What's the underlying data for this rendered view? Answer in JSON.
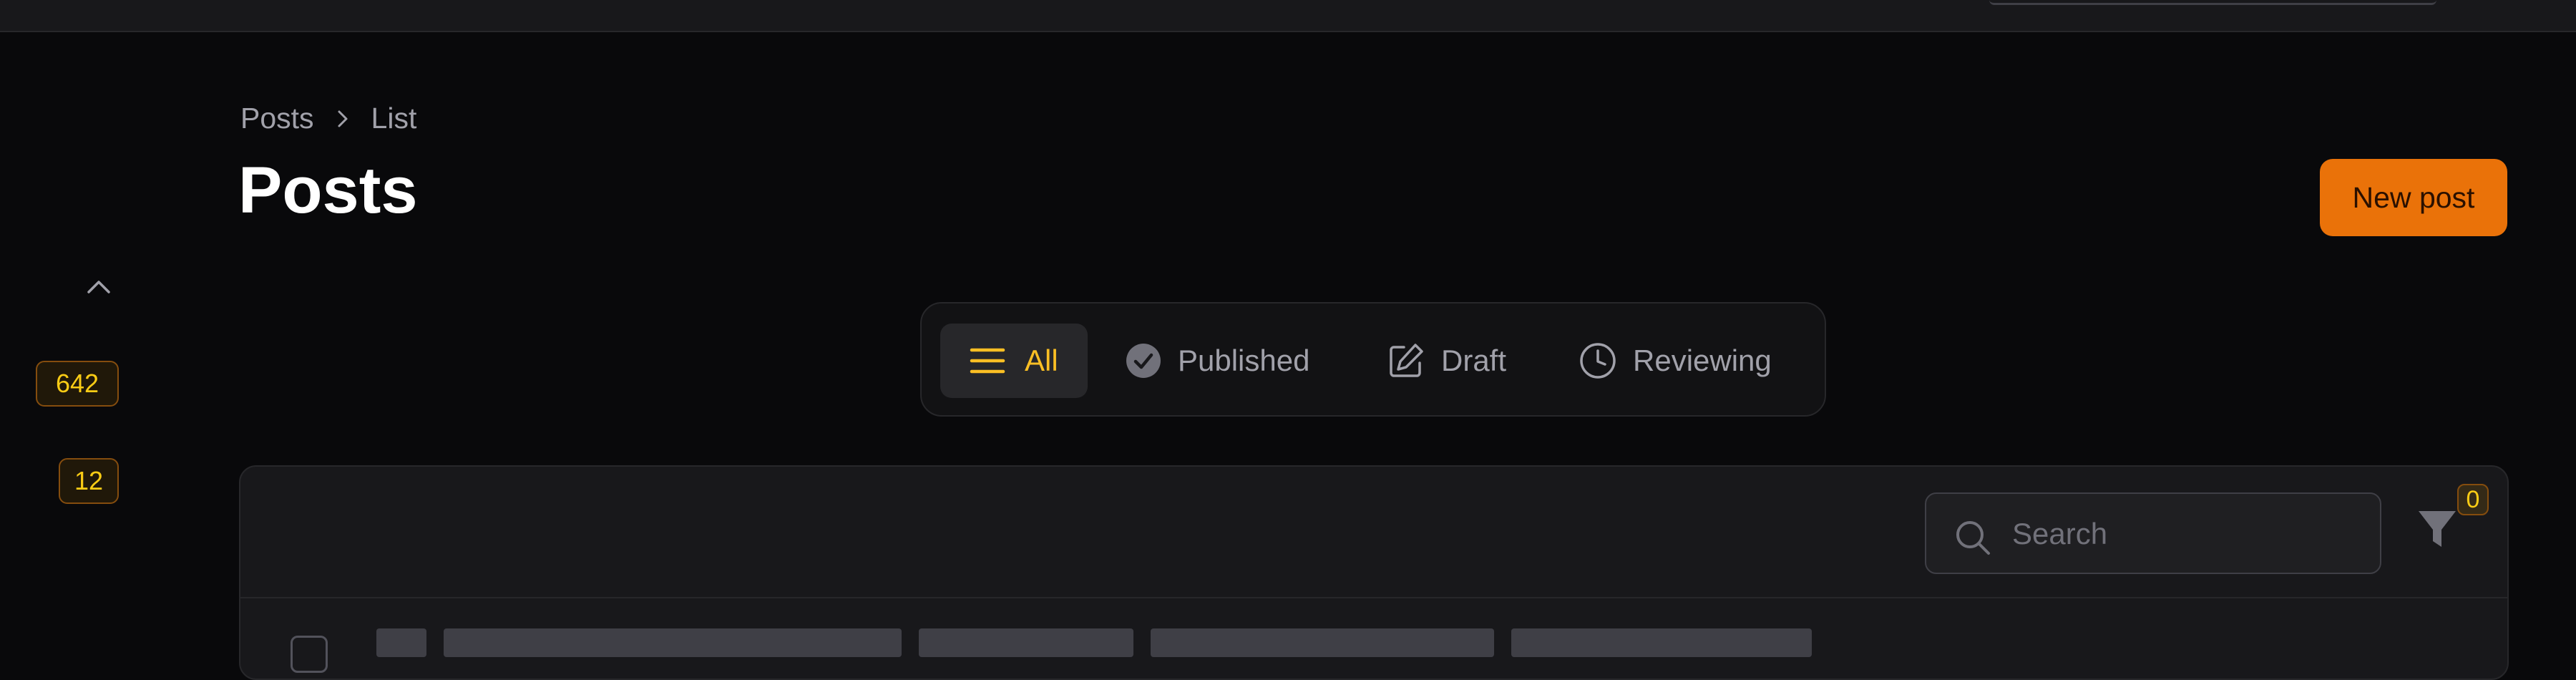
{
  "breadcrumb": {
    "items": [
      "Posts",
      "List"
    ]
  },
  "page": {
    "title": "Posts",
    "new_button": "New post"
  },
  "sidebar": {
    "badges": [
      "642",
      "12"
    ]
  },
  "tabs": [
    {
      "label": "All",
      "icon": "list-icon",
      "active": true
    },
    {
      "label": "Published",
      "icon": "check-circle-icon",
      "active": false
    },
    {
      "label": "Draft",
      "icon": "pencil-square-icon",
      "active": false
    },
    {
      "label": "Reviewing",
      "icon": "clock-icon",
      "active": false
    }
  ],
  "table": {
    "search_placeholder": "Search",
    "filter_count": "0"
  },
  "colors": {
    "accent": "#fbbf24",
    "primary_button": "#ea7209",
    "background": "#09090b",
    "panel": "#18181b"
  }
}
